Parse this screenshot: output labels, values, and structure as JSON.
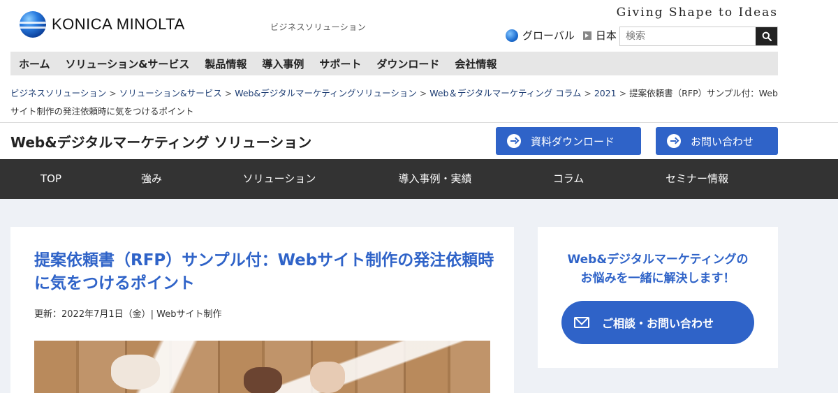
{
  "header": {
    "logo_text": "KONICA MINOLTA",
    "subtitle": "ビジネスソリューション",
    "tagline": "Giving Shape to Ideas",
    "global_link": "グローバル",
    "japan_link": "日本",
    "search_placeholder": "検索"
  },
  "global_nav": [
    "ホーム",
    "ソリューション&サービス",
    "製品情報",
    "導入事例",
    "サポート",
    "ダウンロード",
    "会社情報"
  ],
  "breadcrumb": {
    "items": [
      "ビジネスソリューション",
      "ソリューション&サービス",
      "Web&デジタルマーケティングソリューション",
      "Web＆デジタルマーケティング コラム",
      "2021"
    ],
    "current": "提案依頼書（RFP）サンプル付：Webサイト制作の発注依頼時に気をつけるポイント",
    "separator": ">"
  },
  "section": {
    "title": "Web&デジタルマーケティング ソリューション",
    "download_label": "資料ダウンロード",
    "contact_label": "お問い合わせ"
  },
  "sub_nav": [
    "TOP",
    "強み",
    "ソリューション",
    "導入事例・実績",
    "コラム",
    "セミナー情報"
  ],
  "article": {
    "title": "提案依頼書（RFP）サンプル付：Webサイト制作の発注依頼時に気をつけるポイント",
    "meta": "更新：2022年7月1日（金）| Webサイト制作"
  },
  "sidebar": {
    "heading_line1": "Web&デジタルマーケティングの",
    "heading_line2": "お悩みを一緒に解決します！",
    "consult_label": "ご相談・お問い合わせ"
  },
  "colors": {
    "accent_blue": "#2f63c8",
    "dark_nav": "#333333",
    "content_bg": "#eef1f6"
  }
}
